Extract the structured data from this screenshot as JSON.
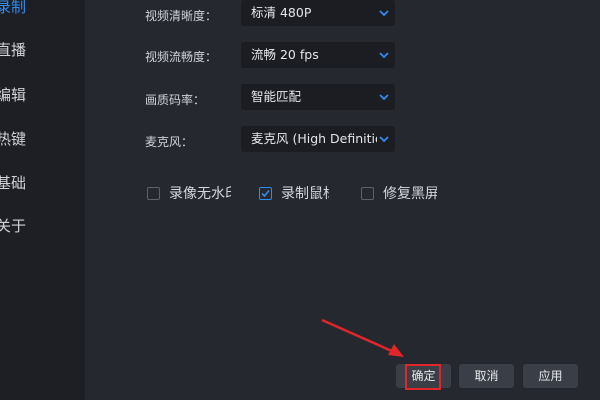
{
  "sidebar": {
    "items": [
      {
        "label": "录制",
        "active": true
      },
      {
        "label": "直播",
        "active": false
      },
      {
        "label": "编辑",
        "active": false
      },
      {
        "label": "热键",
        "active": false
      },
      {
        "label": "基础",
        "active": false
      },
      {
        "label": "关于",
        "active": false
      }
    ]
  },
  "settings": {
    "video_clarity": {
      "label": "视频清晰度：",
      "value": "标清 480P"
    },
    "video_fluency": {
      "label": "视频流畅度：",
      "value": "流畅 20 fps"
    },
    "quality_bitrate": {
      "label": "画质码率：",
      "value": "智能匹配"
    },
    "microphone": {
      "label": "麦克风：",
      "value": "麦克风 (High Definition"
    }
  },
  "checkboxes": [
    {
      "label": "录像无水印",
      "checked": false
    },
    {
      "label": "录制鼠标",
      "checked": true
    },
    {
      "label": "修复黑屏",
      "checked": false
    }
  ],
  "footer": {
    "confirm_label": "确定",
    "cancel_label": "取消",
    "apply_label": "应用"
  },
  "colors": {
    "accent": "#2f8cf0",
    "annotation": "#e0262b",
    "background": "#25282f",
    "sidebar": "#1d1f25"
  }
}
